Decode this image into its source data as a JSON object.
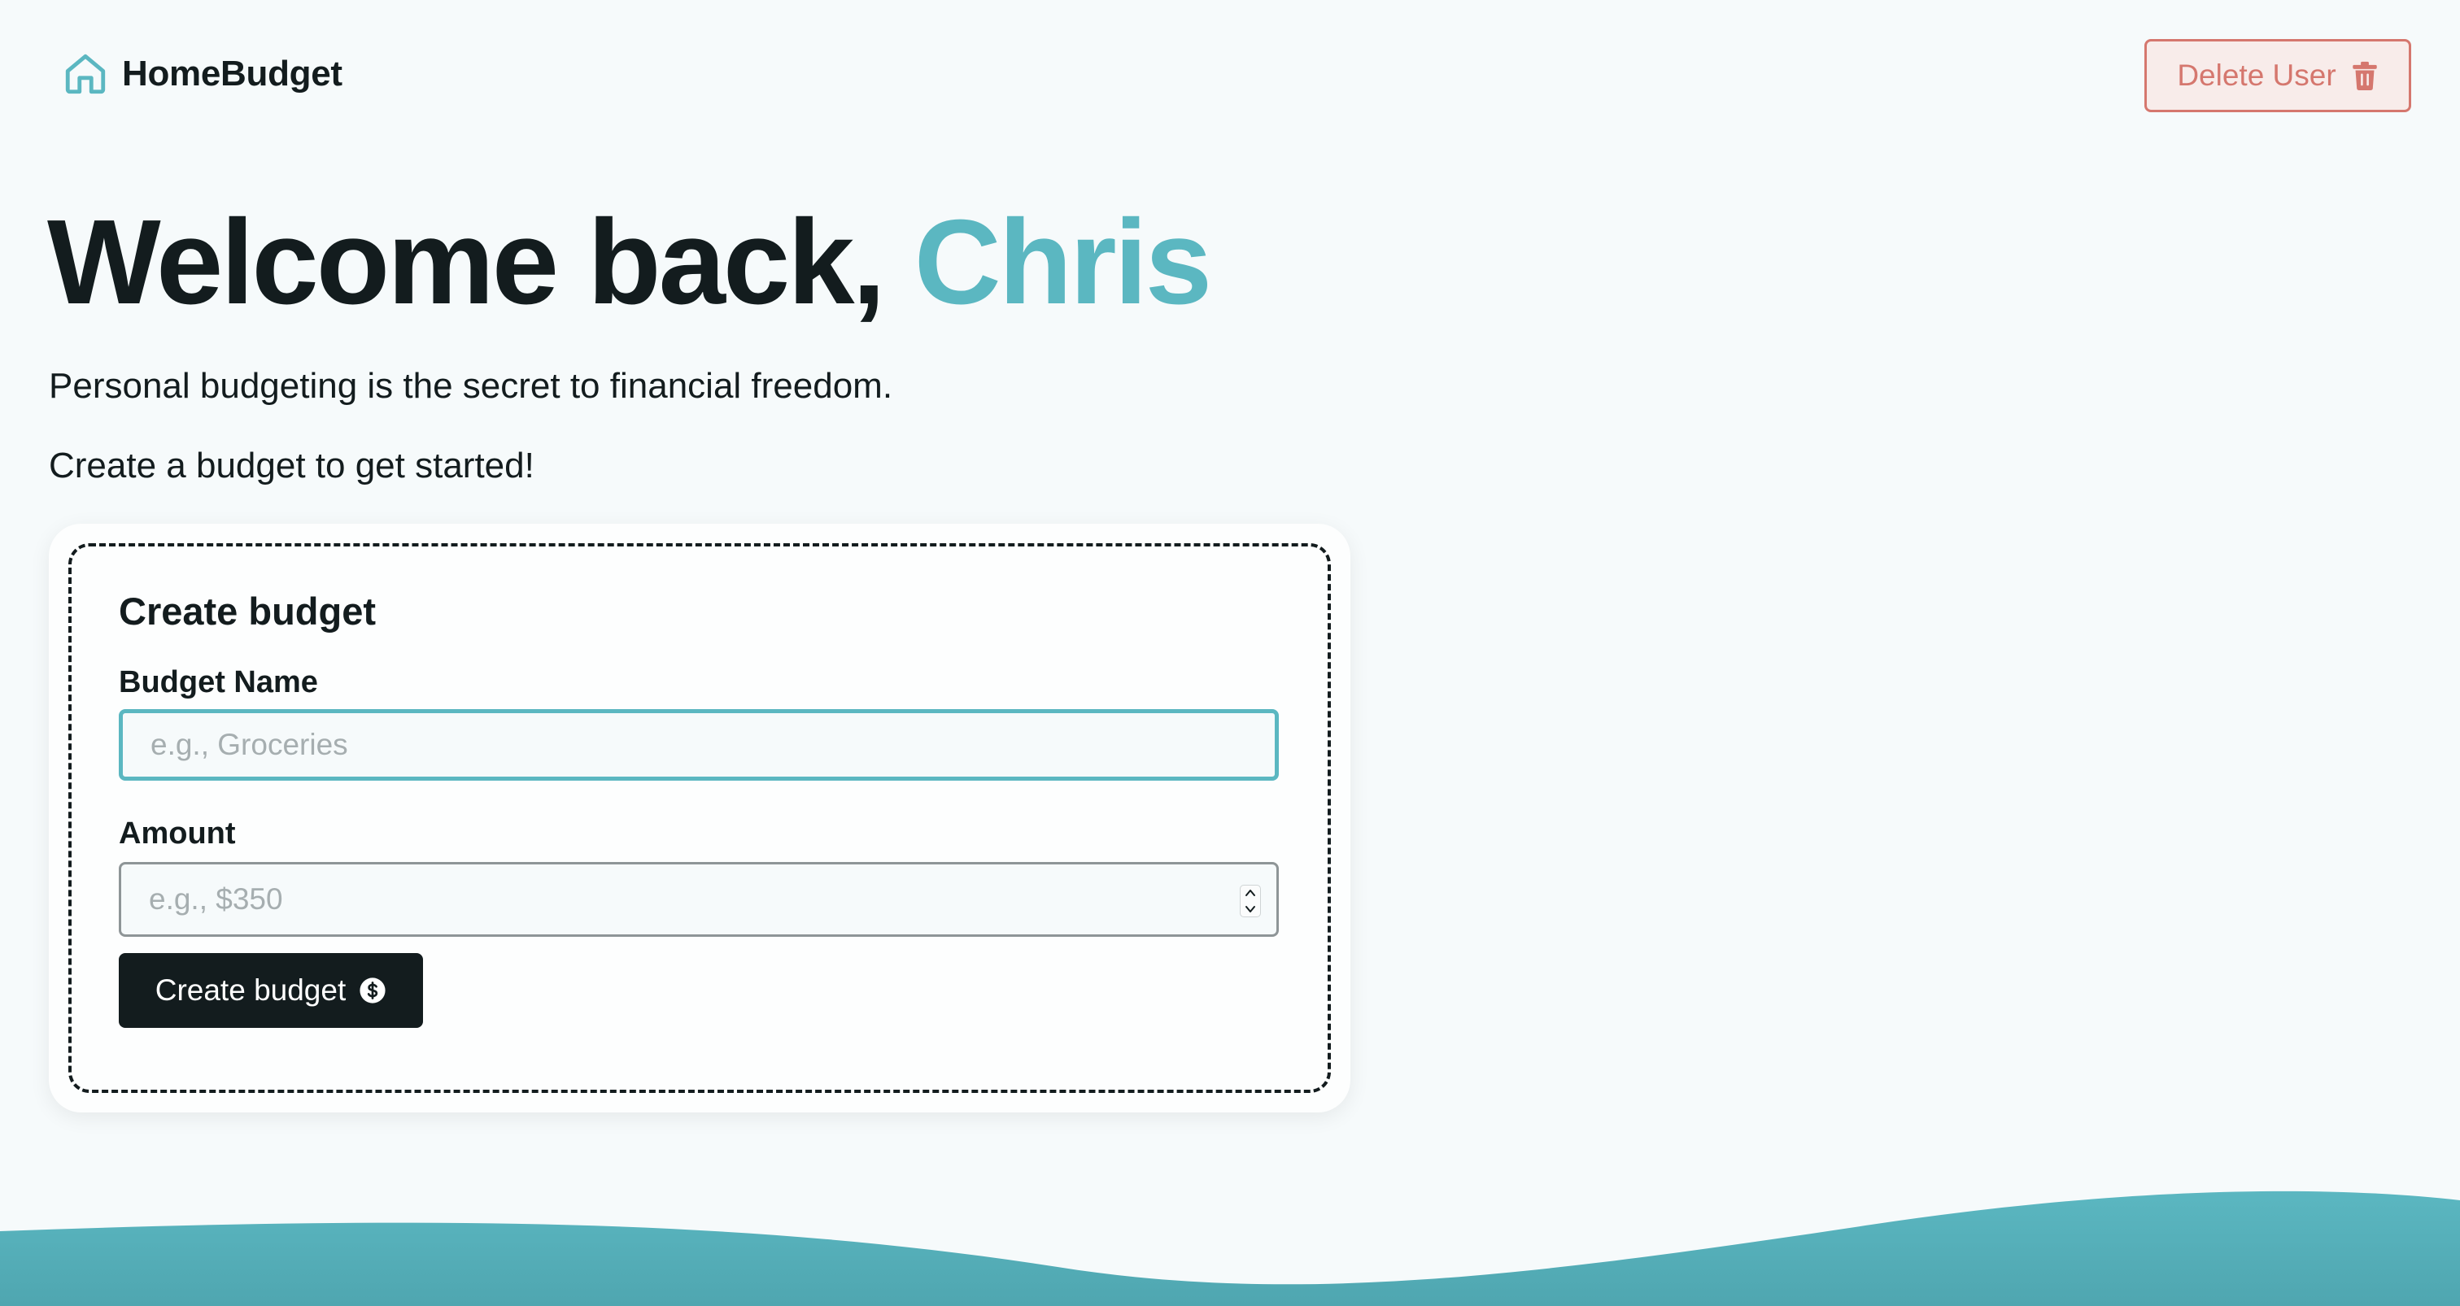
{
  "header": {
    "brand_name": "HomeBudget",
    "brand_icon": "home-icon",
    "delete_user_label": "Delete User",
    "delete_icon": "trash-icon"
  },
  "hero": {
    "greeting": "Welcome back,",
    "user_name": "Chris",
    "subtitle": "Personal budgeting is the secret to financial freedom.",
    "prompt": "Create a budget to get started!"
  },
  "create_budget_form": {
    "title": "Create budget",
    "name_label": "Budget Name",
    "name_placeholder": "e.g., Groceries",
    "name_value": "",
    "amount_label": "Amount",
    "amount_placeholder": "e.g., $350",
    "amount_value": "",
    "submit_label": "Create budget",
    "submit_icon": "dollar-icon"
  },
  "colors": {
    "accent": "#5bb7c1",
    "danger": "#d5776e",
    "text": "#131c1e",
    "background": "#f6fafb"
  }
}
